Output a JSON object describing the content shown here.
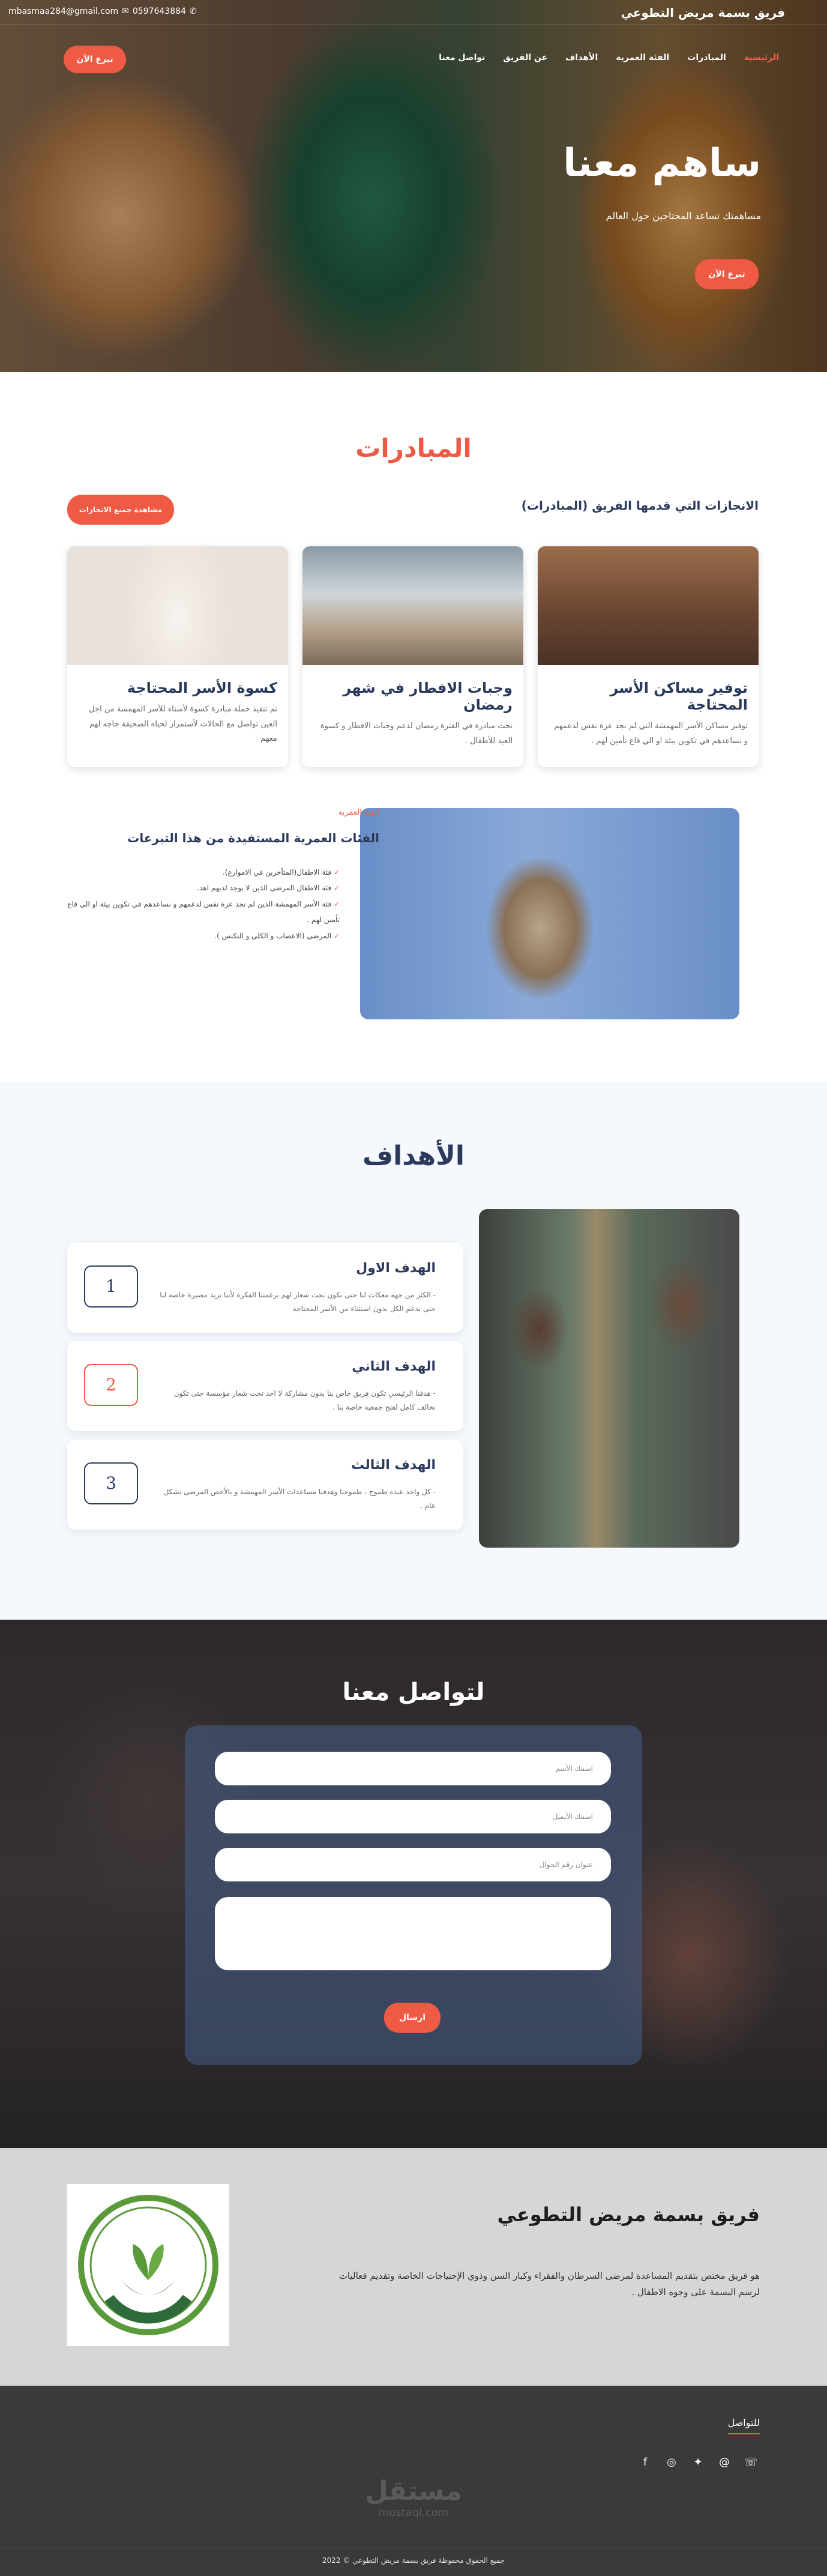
{
  "topbar": {
    "brand": "فريق بسمة مريض التطوعي",
    "email": "mbasmaa284@gmail.com",
    "phone": "0597643884"
  },
  "nav": {
    "items": [
      "الرئيسية",
      "المبادرات",
      "الفئة العمرية",
      "الأهداف",
      "عن الفريق",
      "تواصل معنا"
    ],
    "donate_label": "تبرع الآن"
  },
  "hero": {
    "title": "ساهم معنا",
    "subtitle": "مساهمتك تساعد المحتاجين حول العالم",
    "donate_label": "تبرع الآن"
  },
  "initiatives": {
    "title": "المبادرات",
    "subtitle": "الانجازات التي قدمها الفريق (المبادرات)",
    "view_all_label": "مشاهدة جميع الانجازات",
    "cards": [
      {
        "title": "توفير مساكن الأسر المحتاجة",
        "text": "توفير مساكن الأسر المهمشة التي لم نجد عزة نفس لدعمهم و نساعدهم في تكوين بيئة او الي قاع تأمين لهم ."
      },
      {
        "title": "وجبات الافطار في شهر رمضان",
        "text": "تحت مبادرة في الفترة رمضان لدعم وجبات الافطار و كسوة العيد للأطفال ."
      },
      {
        "title": "كسوة الأسر المحتاجة",
        "text": "تم تنفيذ حملة مبادرة كسوة لأشتاء للأسر المهمشة من اجل العين تواصل مع الحالات لأستمرار لحياه الصحيفة حاجه لهم معهم"
      }
    ]
  },
  "age_groups": {
    "eyebrow": "الفئة العمرية",
    "title": "الفئات العمرية المستفيدة من هذا التبرعات",
    "items": [
      "فئة الاطفال(المتأخرين في الاموارع).",
      "فئة الاطفال المرضى الذين لا يوجد لديهم اهد.",
      "فئة الأسر المهمشة الذين لم نجد عزة نفس لدعمهم و نساعدهم في تكوين بيئة او الي قاع تأمين لهم .",
      "المرضى (الاعصاب و الكلى و التكنس )."
    ]
  },
  "goals": {
    "title": "الأهداف",
    "items": [
      {
        "num": "1",
        "title": "الهدف الاول",
        "text": "- الكثر من جهة معكات لنا حتى نكون تحت شعار لهم برغمتنا الفكرة لأننا نريد مصيرة خاصة لنا حتى ندعم الكل بدون استثناء من الأسر المحتاجة"
      },
      {
        "num": "2",
        "title": "الهدف الثاني",
        "text": "- هدفنا الرئيسي تكون فريق خاص بنا بدون مشاركة لا احد تحت شعار مؤسسة حتى تكون نخالف كامل لفتح جمعية خاصة بنا ."
      },
      {
        "num": "3",
        "title": "الهدف الثالث",
        "text": "- كل واحد عنده طموح ، طموحنا وهدفنا مساعدات الأسر المهمشة و بالأخص المرضى بشكل عام ."
      }
    ]
  },
  "contact": {
    "title": "لتواصل معنا",
    "name_placeholder": "اسمك الأسم",
    "email_placeholder": "اسمك الأيميل",
    "subject_placeholder": "عنوان رقم الجوال",
    "send_label": "ارسال"
  },
  "about": {
    "title": "فريق بسمة مريض التطوعي",
    "text": "هو فريق مختص بتقديم المساعدة لمرضى السرطان والفقراء وكبار السن وذوي الإحتياجات الخاصة وتقديم فعاليات لرسم البسمة على وجوه الاطفال .",
    "logo_text": "فريق بسمة مريض التطوعي"
  },
  "footer": {
    "contact_heading": "للتواصل",
    "watermark_ar": "مستقل",
    "watermark_en": "mostaql.com",
    "copyright": "جميع الحقوق محفوظة فريق بسمة مريض التطوعي © 2022",
    "social_icons": [
      "facebook-icon",
      "instagram-icon",
      "twitter-icon",
      "email-icon",
      "whatsapp-icon"
    ]
  },
  "colors": {
    "accent": "#ef5a45",
    "navy": "#2b3a5c",
    "footer_bg": "#3a3a3c",
    "about_bg": "#d6d6d6"
  }
}
